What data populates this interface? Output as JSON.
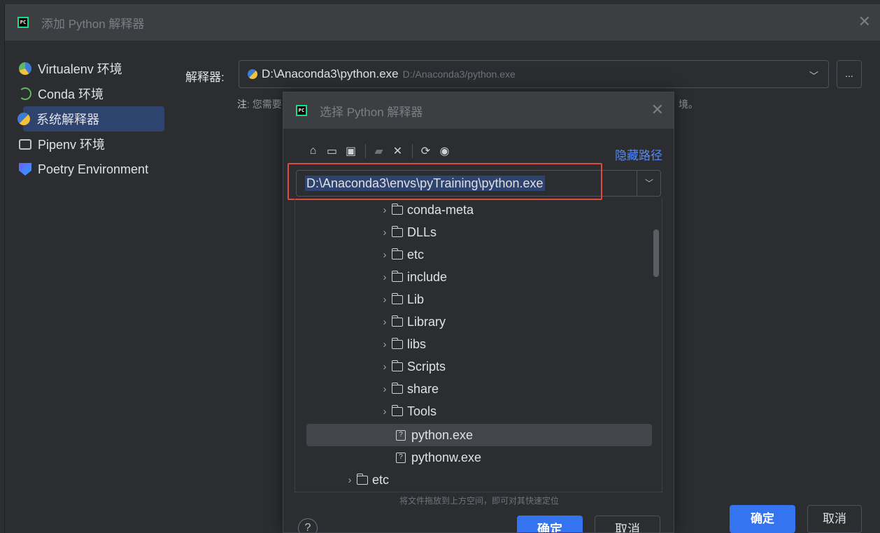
{
  "outer": {
    "title": "添加 Python 解释器",
    "close": "✕",
    "sidebar": [
      {
        "label": "Virtualenv 环境",
        "icon": "virtualenv-icon"
      },
      {
        "label": "Conda 环境",
        "icon": "conda-icon"
      },
      {
        "label": "系统解释器",
        "icon": "python-icon"
      },
      {
        "label": "Pipenv 环境",
        "icon": "pipenv-icon"
      },
      {
        "label": "Poetry Environment",
        "icon": "poetry-icon"
      }
    ],
    "interpreter_label": "解释器:",
    "interpreter_value": "D:\\Anaconda3\\python.exe",
    "interpreter_path": "D:/Anaconda3/python.exe",
    "browse_label": "...",
    "note_prefix": "注",
    "note_text": ": 您需要",
    "note_tail": "境。",
    "ok_label": "确定",
    "cancel_label": "取消"
  },
  "inner": {
    "title": "选择 Python 解释器",
    "close": "✕",
    "toolbar": [
      {
        "name": "home-icon",
        "glyph": "⌂"
      },
      {
        "name": "desktop-icon",
        "glyph": "▭"
      },
      {
        "name": "project-folder-icon",
        "glyph": "▣"
      },
      {
        "name": "new-folder-icon",
        "glyph": "▰"
      },
      {
        "name": "delete-icon",
        "glyph": "✕"
      },
      {
        "name": "refresh-icon",
        "glyph": "⟳"
      },
      {
        "name": "show-hidden-icon",
        "glyph": "◉"
      }
    ],
    "hide_path_label": "隐藏路径",
    "path_value": "D:\\Anaconda3\\envs\\pyTraining\\python.exe",
    "tree": [
      {
        "label": "conda-meta",
        "type": "folder",
        "expandable": true
      },
      {
        "label": "DLLs",
        "type": "folder",
        "expandable": true
      },
      {
        "label": "etc",
        "type": "folder",
        "expandable": true
      },
      {
        "label": "include",
        "type": "folder",
        "expandable": true
      },
      {
        "label": "Lib",
        "type": "folder",
        "expandable": true
      },
      {
        "label": "Library",
        "type": "folder",
        "expandable": true
      },
      {
        "label": "libs",
        "type": "folder",
        "expandable": true
      },
      {
        "label": "Scripts",
        "type": "folder",
        "expandable": true
      },
      {
        "label": "share",
        "type": "folder",
        "expandable": true
      },
      {
        "label": "Tools",
        "type": "folder",
        "expandable": true
      },
      {
        "label": "python.exe",
        "type": "file",
        "expandable": false,
        "selected": true
      },
      {
        "label": "pythonw.exe",
        "type": "file",
        "expandable": false
      },
      {
        "label": "etc",
        "type": "folder",
        "expandable": true,
        "outdent": true
      }
    ],
    "hint": "将文件拖放到上方空间，即可对其快速定位",
    "help_label": "?",
    "ok_label": "确定",
    "cancel_label": "取消"
  },
  "colors": {
    "accent": "#3574f0",
    "selection": "#2e436e",
    "highlight_box": "#e04a3a",
    "link": "#548af7"
  }
}
